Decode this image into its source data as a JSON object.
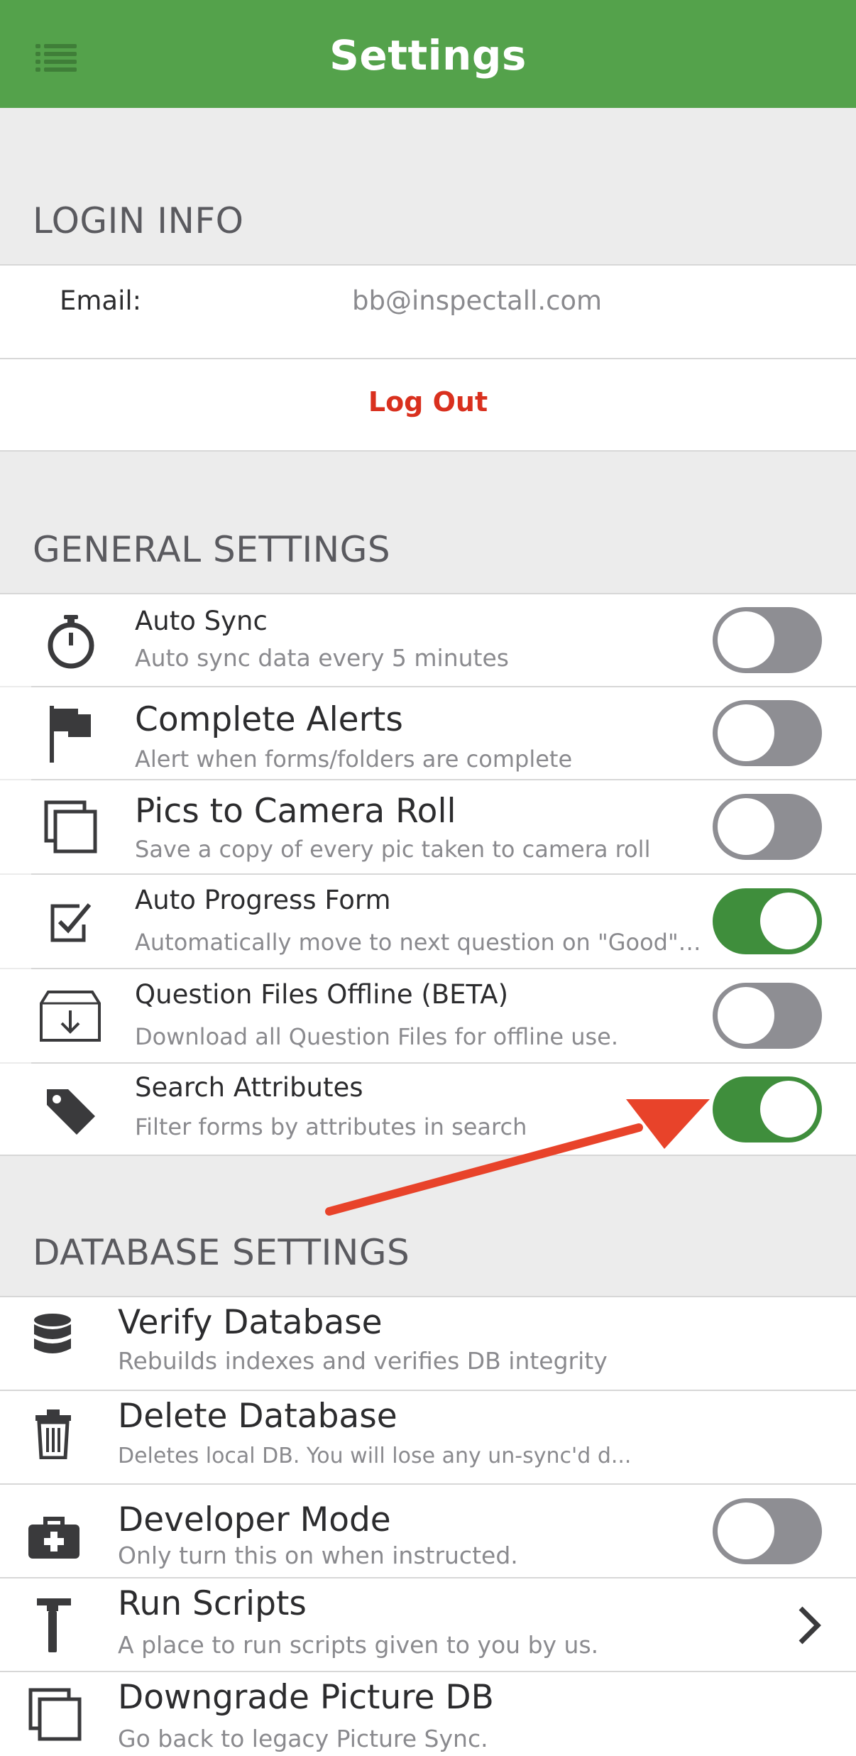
{
  "nav": {
    "title": "Settings"
  },
  "login_info": {
    "header": "LOGIN INFO",
    "email_label": "Email:",
    "email_value": "bb@inspectall.com",
    "logout_label": "Log Out"
  },
  "general_settings": {
    "header": "GENERAL SETTINGS",
    "items": [
      {
        "title": "Auto Sync",
        "subtitle": "Auto sync data every 5 minutes",
        "icon": "stopwatch-icon",
        "enabled": false
      },
      {
        "title": "Complete Alerts",
        "subtitle": "Alert when forms/folders are complete",
        "icon": "flag-icon",
        "enabled": false
      },
      {
        "title": "Pics to Camera Roll",
        "subtitle": "Save a copy of every pic taken to camera roll",
        "icon": "photos-icon",
        "enabled": false
      },
      {
        "title": "Auto Progress Form",
        "subtitle": "Automatically move to next question on \"Good\" or \"...",
        "icon": "checkbox-icon",
        "enabled": true
      },
      {
        "title": "Question Files Offline (BETA)",
        "subtitle": "Download all Question Files for offline use.",
        "icon": "download-box-icon",
        "enabled": false
      },
      {
        "title": "Search Attributes",
        "subtitle": "Filter forms by attributes in search",
        "icon": "tag-icon",
        "enabled": true
      }
    ]
  },
  "database_settings": {
    "header": "DATABASE SETTINGS",
    "items": [
      {
        "title": "Verify Database",
        "subtitle": "Rebuilds indexes and verifies DB integrity",
        "icon": "database-icon"
      },
      {
        "title": "Delete Database",
        "subtitle": "Deletes local DB. You will lose any un-sync'd d...",
        "icon": "trash-icon"
      },
      {
        "title": "Developer Mode",
        "subtitle": "Only turn this on when instructed.",
        "icon": "medkit-icon",
        "enabled": false
      },
      {
        "title": "Run Scripts",
        "subtitle": "A place to run scripts given to you by us.",
        "icon": "hammer-icon"
      },
      {
        "title": "Downgrade Picture DB",
        "subtitle": "Go back to legacy Picture Sync.",
        "icon": "photos-icon"
      }
    ]
  },
  "colors": {
    "nav_green": "#54a24b",
    "toggle_on": "#3f8e3c",
    "toggle_off": "#8e8e93",
    "logout_red": "#d9301e",
    "arrow_red": "#e8432a"
  }
}
